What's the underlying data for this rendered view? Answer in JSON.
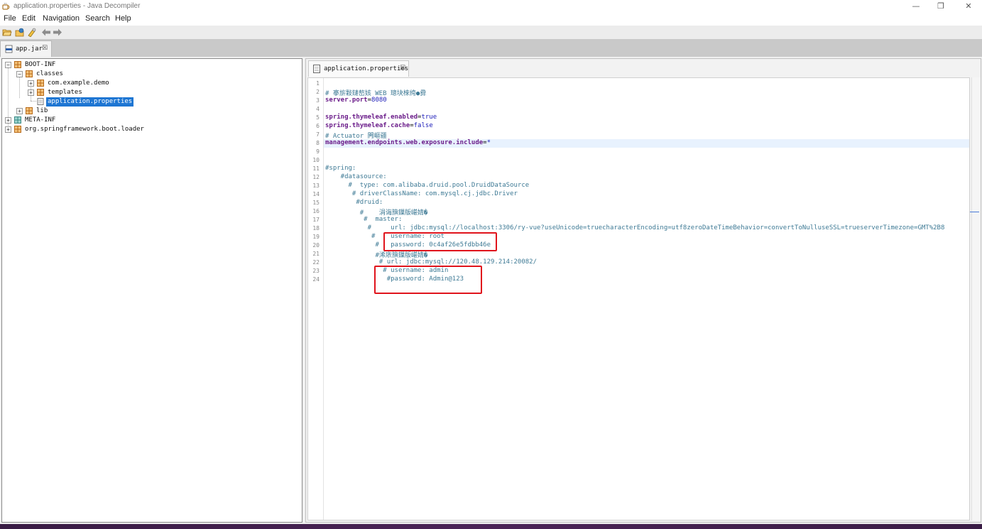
{
  "window": {
    "title": "application.properties - Java Decompiler",
    "minimize_glyph": "—",
    "restore_glyph": "❐",
    "close_glyph": "✕"
  },
  "menu": [
    "File",
    "Edit",
    "Navigation",
    "Search",
    "Help"
  ],
  "toolbar": {
    "icons": [
      "open-file-icon",
      "open-type-icon",
      "search-icon",
      "back-arrow-icon",
      "forward-arrow-icon"
    ]
  },
  "jar_tab": {
    "label": "app.jar",
    "close": "☒"
  },
  "tree": {
    "expanded": "−",
    "collapsed": "+",
    "items": [
      {
        "label": "BOOT-INF"
      },
      {
        "label": "classes"
      },
      {
        "label": "com.example.demo"
      },
      {
        "label": "templates"
      },
      {
        "label": "application.properties",
        "selected": true
      },
      {
        "label": "lib"
      },
      {
        "label": "META-INF"
      },
      {
        "label": "org.springframework.boot.loader"
      }
    ]
  },
  "editor": {
    "tab_label": "application.properties",
    "tab_close": "☒",
    "line_numbers": [
      "1",
      "2",
      "3",
      "4",
      "5",
      "6",
      "7",
      "8",
      "9",
      "10",
      "11",
      "12",
      "13",
      "14",
      "15",
      "16",
      "17",
      "18",
      "19",
      "20",
      "21",
      "22",
      "23",
      "24"
    ],
    "lines": {
      "l2": "# 搴旂敤鏈嶅姟 WEB 璁块棶绔●彛",
      "l3": {
        "key": "server.port",
        "eq": "=",
        "value": "8080"
      },
      "l5": {
        "key": "spring.thymeleaf.enabled",
        "eq": "=",
        "value": "true"
      },
      "l6": {
        "key": "spring.thymeleaf.cache",
        "eq": "=",
        "value": "false"
      },
      "l7": "# Actuator 闁嶇疆",
      "l8": {
        "key": "management.endpoints.web.exposure.include",
        "eq": "=",
        "value": "*"
      },
      "l11": "#spring:",
      "l12": "    #datasource:",
      "l13": "      #  type: com.alibaba.druid.pool.DruidDataSource",
      "l14": "       # driverClassName: com.mysql.cj.jdbc.Driver",
      "l15": "        #druid:",
      "l16": "         #    涓诲簱鏁版嵁婧�",
      "l17": "          #  master:",
      "l18": "           #     url: jdbc:mysql://localhost:3306/ry-vue?useUnicode=truecharacterEncoding=utf8zeroDateTimeBehavior=convertToNulluseSSL=trueserverTimezone=GMT%2B8",
      "l19": "            #    username: root",
      "l20": "             #   password: 0c4af26e5fdbb46e",
      "l21": "             #浠庡簱鏁版嵁婧�",
      "l22": "              # url: jdbc:mysql://120.48.129.214:20082/",
      "l23": "               # username: admin",
      "l24": "                #password: Admin@123"
    }
  },
  "colors": {
    "selection": "#1e76d3",
    "annotation_box": "#e0141c",
    "comment": "#3e7a95",
    "key": "#6b1d8a",
    "value": "#1a1ab8"
  }
}
